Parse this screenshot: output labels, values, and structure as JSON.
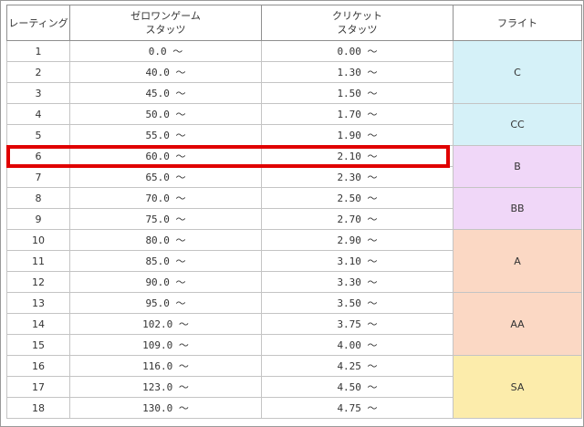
{
  "headers": {
    "rating": "レーティング",
    "zero_one_line1": "ゼロワンゲーム",
    "zero_one_line2": "スタッツ",
    "cricket_line1": "クリケット",
    "cricket_line2": "スタッツ",
    "flight": "フライト"
  },
  "rows": [
    {
      "rating": "1",
      "zero_one": "0.0 〜",
      "cricket": "0.00 〜"
    },
    {
      "rating": "2",
      "zero_one": "40.0 〜",
      "cricket": "1.30 〜"
    },
    {
      "rating": "3",
      "zero_one": "45.0 〜",
      "cricket": "1.50 〜"
    },
    {
      "rating": "4",
      "zero_one": "50.0 〜",
      "cricket": "1.70 〜"
    },
    {
      "rating": "5",
      "zero_one": "55.0 〜",
      "cricket": "1.90 〜"
    },
    {
      "rating": "6",
      "zero_one": "60.0 〜",
      "cricket": "2.10 〜"
    },
    {
      "rating": "7",
      "zero_one": "65.0 〜",
      "cricket": "2.30 〜"
    },
    {
      "rating": "8",
      "zero_one": "70.0 〜",
      "cricket": "2.50 〜"
    },
    {
      "rating": "9",
      "zero_one": "75.0 〜",
      "cricket": "2.70 〜"
    },
    {
      "rating": "10",
      "zero_one": "80.0 〜",
      "cricket": "2.90 〜"
    },
    {
      "rating": "11",
      "zero_one": "85.0 〜",
      "cricket": "3.10 〜"
    },
    {
      "rating": "12",
      "zero_one": "90.0 〜",
      "cricket": "3.30 〜"
    },
    {
      "rating": "13",
      "zero_one": "95.0 〜",
      "cricket": "3.50 〜"
    },
    {
      "rating": "14",
      "zero_one": "102.0 〜",
      "cricket": "3.75 〜"
    },
    {
      "rating": "15",
      "zero_one": "109.0 〜",
      "cricket": "4.00 〜"
    },
    {
      "rating": "16",
      "zero_one": "116.0 〜",
      "cricket": "4.25 〜"
    },
    {
      "rating": "17",
      "zero_one": "123.0 〜",
      "cricket": "4.50 〜"
    },
    {
      "rating": "18",
      "zero_one": "130.0 〜",
      "cricket": "4.75 〜"
    }
  ],
  "flights": [
    {
      "label": "C",
      "color": "#d5f1f8"
    },
    {
      "label": "CC",
      "color": "#d5f1f8"
    },
    {
      "label": "B",
      "color": "#f0d7f8"
    },
    {
      "label": "BB",
      "color": "#f0d7f8"
    },
    {
      "label": "A",
      "color": "#fbd8c4"
    },
    {
      "label": "AA",
      "color": "#fbd8c4"
    },
    {
      "label": "SA",
      "color": "#fcecab"
    }
  ],
  "highlight_color": "#e00000"
}
